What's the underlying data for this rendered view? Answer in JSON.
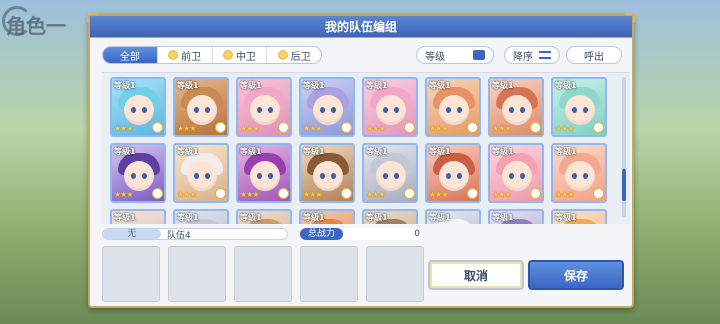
{
  "background": {
    "title": "角色一"
  },
  "dialog": {
    "title": "我的队伍编组",
    "tabs": [
      {
        "label": "全部",
        "active": true
      },
      {
        "label": "前卫",
        "active": false
      },
      {
        "label": "中卫",
        "active": false
      },
      {
        "label": "后卫",
        "active": false
      }
    ],
    "controls": {
      "level_label": "等级",
      "sort_label": "降序",
      "call_label": "呼出"
    },
    "characters": [
      {
        "level": "等级1",
        "stars": "★★★",
        "c1": "#a9e1f5",
        "c2": "#5bb6e4",
        "hair": "#6fd0e8"
      },
      {
        "level": "等级1",
        "stars": "★★★",
        "c1": "#e8b889",
        "c2": "#b8703e",
        "hair": "#c98b54"
      },
      {
        "level": "等级1",
        "stars": "★★★",
        "c1": "#f7c6d8",
        "c2": "#e48fb4",
        "hair": "#f1a8c8"
      },
      {
        "level": "等级1",
        "stars": "★★★",
        "c1": "#cbd2f1",
        "c2": "#8d97d8",
        "hair": "#a9a2e0"
      },
      {
        "level": "等级1",
        "stars": "★★★",
        "c1": "#f9cfe2",
        "c2": "#e893bb",
        "hair": "#f2a7c9"
      },
      {
        "level": "等级1",
        "stars": "★★★",
        "c1": "#f7d5b8",
        "c2": "#e49a68",
        "hair": "#e69266"
      },
      {
        "level": "等级1",
        "stars": "★★★",
        "c1": "#f8d2c6",
        "c2": "#e08a62",
        "hair": "#d77452"
      },
      {
        "level": "等级1",
        "stars": "★★★",
        "c1": "#c6f0ea",
        "c2": "#7fcfc4",
        "hair": "#8ed8cc"
      },
      {
        "level": "等级1",
        "stars": "★★★",
        "c1": "#d4c6f2",
        "c2": "#7a5cc4",
        "hair": "#5c3f9e"
      },
      {
        "level": "等级1",
        "stars": "★★★",
        "c1": "#f6e6d2",
        "c2": "#d9b08a",
        "hair": "#f2ecea"
      },
      {
        "level": "等级1",
        "stars": "★★★",
        "c1": "#e2b6e8",
        "c2": "#a056b6",
        "hair": "#9a3fae"
      },
      {
        "level": "等级1",
        "stars": "★★★",
        "c1": "#f0d8c0",
        "c2": "#b08058",
        "hair": "#8a5a38"
      },
      {
        "level": "等级1",
        "stars": "★★★",
        "c1": "#e4e6ee",
        "c2": "#a6abbd",
        "hair": "#c4c8d6"
      },
      {
        "level": "等级1",
        "stars": "★★★",
        "c1": "#f8cec0",
        "c2": "#d87258",
        "hair": "#cc5e44"
      },
      {
        "level": "等级1",
        "stars": "★★★",
        "c1": "#fbd6de",
        "c2": "#ef98aa",
        "hair": "#f3a2b4"
      },
      {
        "level": "等级1",
        "stars": "★★★",
        "c1": "#fbdcd0",
        "c2": "#f2a084",
        "hair": "#f4a890"
      },
      {
        "level": "等级1",
        "stars": "",
        "c1": "#f2e2d8",
        "c2": "#d8c0b0",
        "hair": "#e8d8d0"
      },
      {
        "level": "等级1",
        "stars": "",
        "c1": "#dfe4ef",
        "c2": "#aab4c8",
        "hair": "#c0c8d8"
      },
      {
        "level": "等级1",
        "stars": "",
        "c1": "#f4dcc8",
        "c2": "#d0a280",
        "hair": "#c89a78"
      },
      {
        "level": "等级1",
        "stars": "",
        "c1": "#f4c8a8",
        "c2": "#d8884e",
        "hair": "#e0884c"
      },
      {
        "level": "等级1",
        "stars": "",
        "c1": "#e8dcc8",
        "c2": "#b8a078",
        "hair": "#a08060"
      },
      {
        "level": "等级1",
        "stars": "",
        "c1": "#dfe6f2",
        "c2": "#aebad2",
        "hair": "#f4f6fa"
      },
      {
        "level": "等级1",
        "stars": "",
        "c1": "#e6e0f4",
        "c2": "#a49ad0",
        "hair": "#8c82c0"
      },
      {
        "level": "等级1",
        "stars": "",
        "c1": "#fbe0c8",
        "c2": "#f0b070",
        "hair": "#f0a860"
      }
    ],
    "team": {
      "number": "无",
      "name": "队伍4"
    },
    "power": {
      "label": "总战力",
      "value": "0"
    },
    "buttons": {
      "cancel": "取消",
      "save": "保存"
    }
  }
}
